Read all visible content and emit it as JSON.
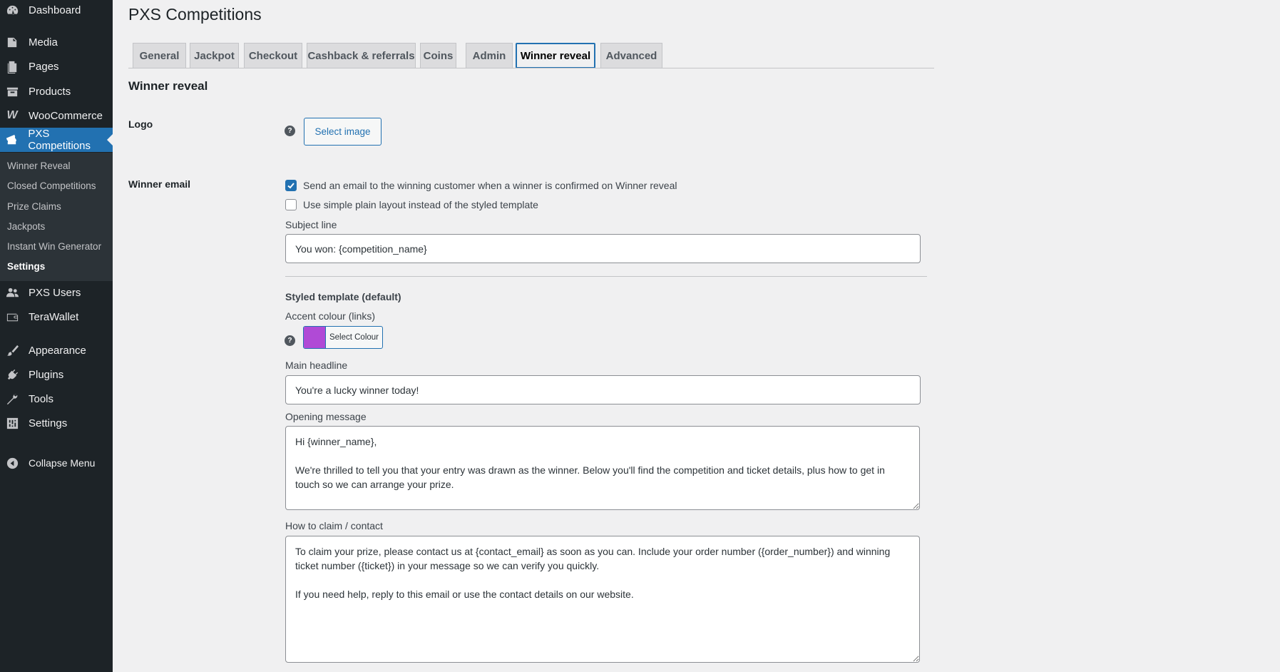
{
  "sidebar": {
    "menu": [
      {
        "label": "Dashboard",
        "icon": "dashboard-icon"
      },
      {
        "label": "Media",
        "icon": "media-icon"
      },
      {
        "label": "Pages",
        "icon": "pages-icon"
      },
      {
        "label": "Products",
        "icon": "products-icon"
      },
      {
        "label": "WooCommerce",
        "icon": "woocommerce-icon"
      },
      {
        "label": "PXS Competitions",
        "icon": "tickets-icon"
      },
      {
        "label": "PXS Users",
        "icon": "users-icon"
      },
      {
        "label": "TeraWallet",
        "icon": "wallet-icon"
      },
      {
        "label": "Appearance",
        "icon": "brush-icon"
      },
      {
        "label": "Plugins",
        "icon": "plugin-icon"
      },
      {
        "label": "Tools",
        "icon": "wrench-icon"
      },
      {
        "label": "Settings",
        "icon": "settings-icon"
      },
      {
        "label": "Collapse Menu",
        "icon": "collapse-icon"
      }
    ],
    "submenu": [
      {
        "label": "Winner Reveal"
      },
      {
        "label": "Closed Competitions"
      },
      {
        "label": "Prize Claims"
      },
      {
        "label": "Jackpots"
      },
      {
        "label": "Instant Win Generator"
      },
      {
        "label": "Settings"
      }
    ]
  },
  "page": {
    "title": "PXS Competitions",
    "tabs": [
      "General",
      "Jackpot",
      "Checkout",
      "Cashback & referrals",
      "Coins",
      "Admin",
      "Winner reveal",
      "Advanced"
    ],
    "active_tab": "Winner reveal",
    "section_title": "Winner reveal"
  },
  "form": {
    "logo_label": "Logo",
    "help_glyph": "?",
    "select_image_label": "Select image",
    "winner_email_label": "Winner email",
    "send_email_label": "Send an email to the winning customer when a winner is confirmed on Winner reveal",
    "send_email_checked": true,
    "plain_layout_label": "Use simple plain layout instead of the styled template",
    "plain_layout_checked": false,
    "subject_label": "Subject line",
    "subject_value": "You won: {competition_name}",
    "styled_template_heading": "Styled template (default)",
    "accent_label": "Accent colour (links)",
    "accent_color": "#b04ad6",
    "select_colour_label": "Select Colour",
    "headline_label": "Main headline",
    "headline_value": "You're a lucky winner today!",
    "opening_label": "Opening message",
    "opening_value": "Hi {winner_name},\n\nWe're thrilled to tell you that your entry was drawn as the winner. Below you'll find the competition and ticket details, plus how to get in touch so we can arrange your prize.",
    "claim_label": "How to claim / contact",
    "claim_value": "To claim your prize, please contact us at {contact_email} as soon as you can. Include your order number ({order_number}) and winning ticket number ({ticket}) in your message so we can verify you quickly.\n\nIf you need help, reply to this email or use the contact details on our website."
  }
}
